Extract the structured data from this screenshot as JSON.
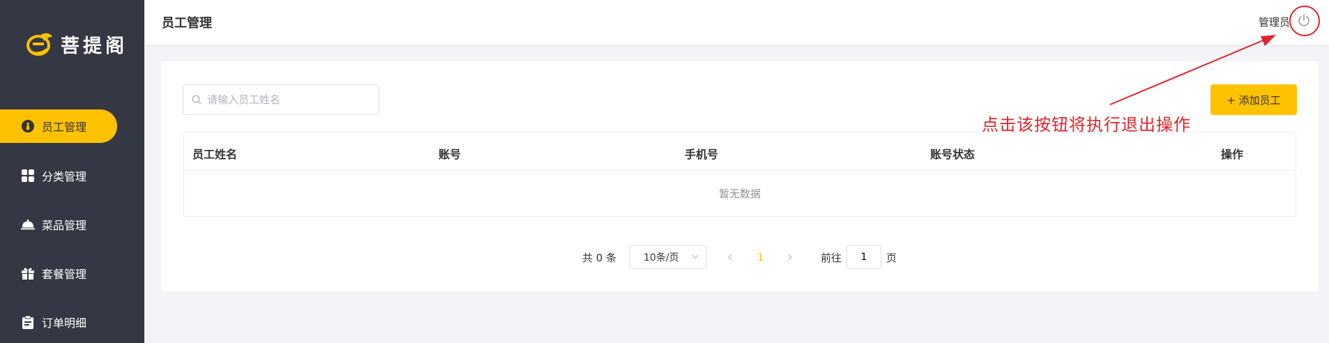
{
  "sidebar": {
    "brand": "菩提阁",
    "items": [
      {
        "label": "员工管理",
        "icon": "tie-icon",
        "active": true
      },
      {
        "label": "分类管理",
        "icon": "grid-icon",
        "active": false
      },
      {
        "label": "菜品管理",
        "icon": "cloche-icon",
        "active": false
      },
      {
        "label": "套餐管理",
        "icon": "gift-icon",
        "active": false
      },
      {
        "label": "订单明细",
        "icon": "clipboard-icon",
        "active": false
      }
    ]
  },
  "header": {
    "title": "员工管理",
    "user": "管理员",
    "logout_icon": "power-icon"
  },
  "toolbar": {
    "search_placeholder": "请输入员工姓名",
    "search_value": "",
    "add_label": "+ 添加员工"
  },
  "table": {
    "columns": [
      "员工姓名",
      "账号",
      "手机号",
      "账号状态",
      "操作"
    ],
    "rows": [],
    "empty_text": "暂无数据"
  },
  "pagination": {
    "total_label": "共 0 条",
    "page_size": "10条/页",
    "current_page": "1",
    "goto_prefix": "前往",
    "goto_value": "1",
    "goto_suffix": "页"
  },
  "annotation": {
    "text": "点击该按钮将执行退出操作"
  },
  "colors": {
    "accent": "#ffc200",
    "sidebar_bg": "#343744",
    "annotation": "#e0242a"
  }
}
